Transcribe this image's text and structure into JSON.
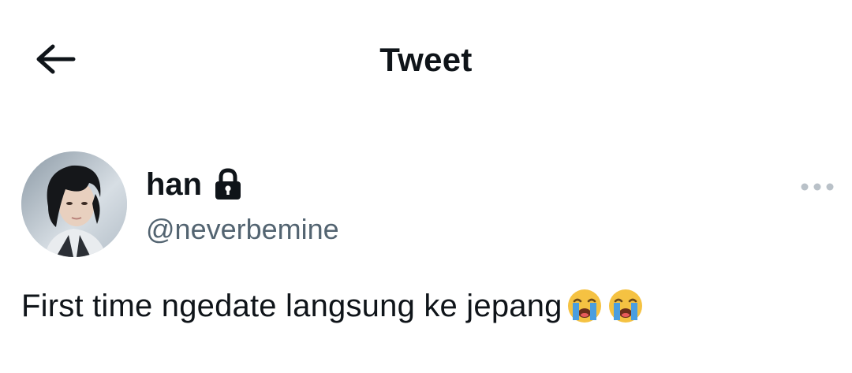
{
  "header": {
    "back_icon": "arrow-left-icon",
    "title": "Tweet"
  },
  "tweet": {
    "author": {
      "display_name": "han",
      "handle": "@neverbemine",
      "protected_icon": "lock-icon",
      "avatar_icon": "avatar"
    },
    "more_icon": "more-horizontal-icon",
    "text": "First time ngedate langsung ke jepang",
    "emojis": [
      "loudly-crying-face-icon",
      "loudly-crying-face-icon"
    ]
  },
  "colors": {
    "text_primary": "#0f1419",
    "text_secondary": "#536471",
    "more_dots": "#b9c1c8",
    "emoji_face": "#f5c242",
    "emoji_tears": "#4a9ee0"
  }
}
